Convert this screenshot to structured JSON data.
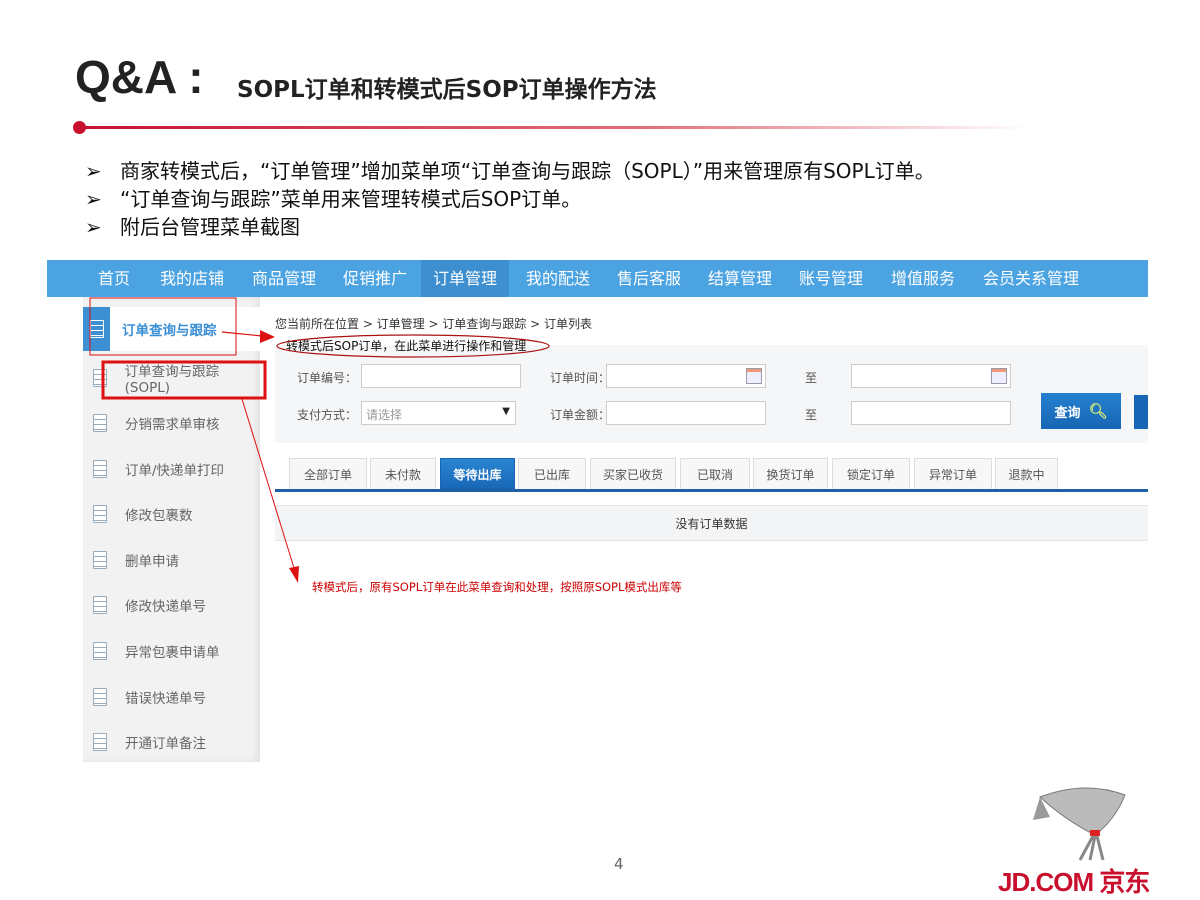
{
  "title": {
    "prefix": "Q&A :",
    "subtitle": "SOPL订单和转模式后SOP订单操作方法"
  },
  "bullets": [
    "商家转模式后，“订单管理”增加菜单项“订单查询与跟踪（SOPL）”用来管理原有SOPL订单。",
    "“订单查询与跟踪”菜单用来管理转模式后SOP订单。",
    "附后台管理菜单截图"
  ],
  "bullet_marker": "➢",
  "nav": [
    "首页",
    "我的店铺",
    "商品管理",
    "促销推广",
    "订单管理",
    "我的配送",
    "售后客服",
    "结算管理",
    "账号管理",
    "增值服务",
    "会员关系管理"
  ],
  "sidebar": [
    "订单查询与跟踪",
    "订单查询与跟踪(SOPL)",
    "分销需求单审核",
    "订单/快递单打印",
    "修改包裹数",
    "删单申请",
    "修改快递单号",
    "异常包裹申请单",
    "错误快递单号",
    "开通订单备注"
  ],
  "breadcrumb": "您当前所在位置 > 订单管理 > 订单查询与跟踪 > 订单列表",
  "annotation_top": "转模式后SOP订单，在此菜单进行操作和管理",
  "annotation_bottom": "转模式后，原有SOPL订单在此菜单查询和处理，按照原SOPL模式出库等",
  "form": {
    "order_no": "订单编号：",
    "order_time": "订单时间：",
    "to": "至",
    "pay_method": "支付方式：",
    "pay_placeholder": "请选择",
    "amount": "订单金额：",
    "query": "查询"
  },
  "tabs": [
    "全部订单",
    "未付款",
    "等待出库",
    "已出库",
    "买家已收货",
    "已取消",
    "换货订单",
    "锁定订单",
    "异常订单",
    "退款中"
  ],
  "no_data": "没有订单数据",
  "page_number": "4",
  "logo": "JD.COM 京东",
  "colors": {
    "nav": "#4ba3e2",
    "accent": "#c8102e",
    "tab_active": "#1766b5"
  }
}
